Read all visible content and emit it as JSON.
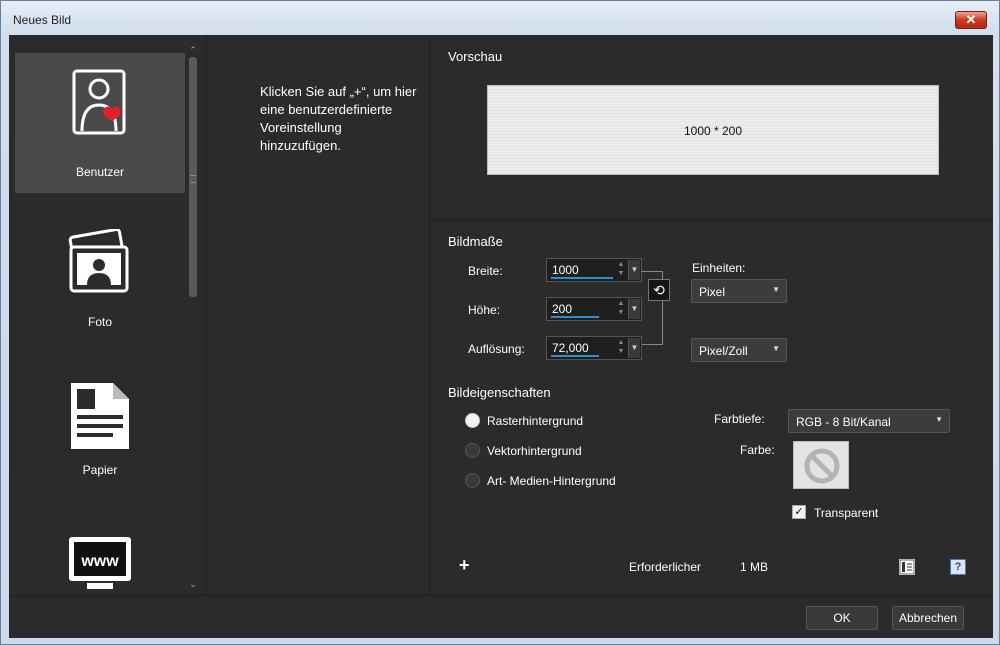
{
  "window": {
    "title": "Neues Bild",
    "close": "✕"
  },
  "presets": [
    {
      "label": "Benutzer",
      "icon": "user-heart-icon",
      "selected": true
    },
    {
      "label": "Foto",
      "icon": "photo-icon",
      "selected": false
    },
    {
      "label": "Papier",
      "icon": "paper-icon",
      "selected": false
    },
    {
      "label": "",
      "icon": "web-monitor-icon",
      "selected": false
    }
  ],
  "web_icon_text": "www",
  "hint": "Klicken Sie auf „+“, um hier eine benutzerdefinierte Voreinstellung hinzuzufügen.",
  "preview": {
    "title": "Vorschau",
    "text": "1000 * 200"
  },
  "dimensions": {
    "title": "Bildmaße",
    "width_label": "Breite:",
    "width_value": "1000",
    "height_label": "Höhe:",
    "height_value": "200",
    "resolution_label": "Auflösung:",
    "resolution_value": "72,000",
    "units_label": "Einheiten:",
    "units_value": "Pixel",
    "resolution_unit": "Pixel/Zoll"
  },
  "properties": {
    "title": "Bildeigenschaften",
    "options": [
      "Rasterhintergrund",
      "Vektorhintergrund",
      "Art- Medien-Hintergrund"
    ],
    "selected_index": 0,
    "depth_label": "Farbtiefe:",
    "depth_value": "RGB - 8 Bit/Kanal",
    "color_label": "Farbe:",
    "transparent_label": "Transparent",
    "transparent_checked": true
  },
  "memory": {
    "label": "Erforderlicher",
    "value": "1 MB"
  },
  "buttons": {
    "add": "+",
    "ok": "OK",
    "cancel": "Abbrechen",
    "help": "?"
  },
  "colors": {
    "accent": "#2b8fd6",
    "panel": "#2b2b2b",
    "heart": "#e0202a"
  }
}
